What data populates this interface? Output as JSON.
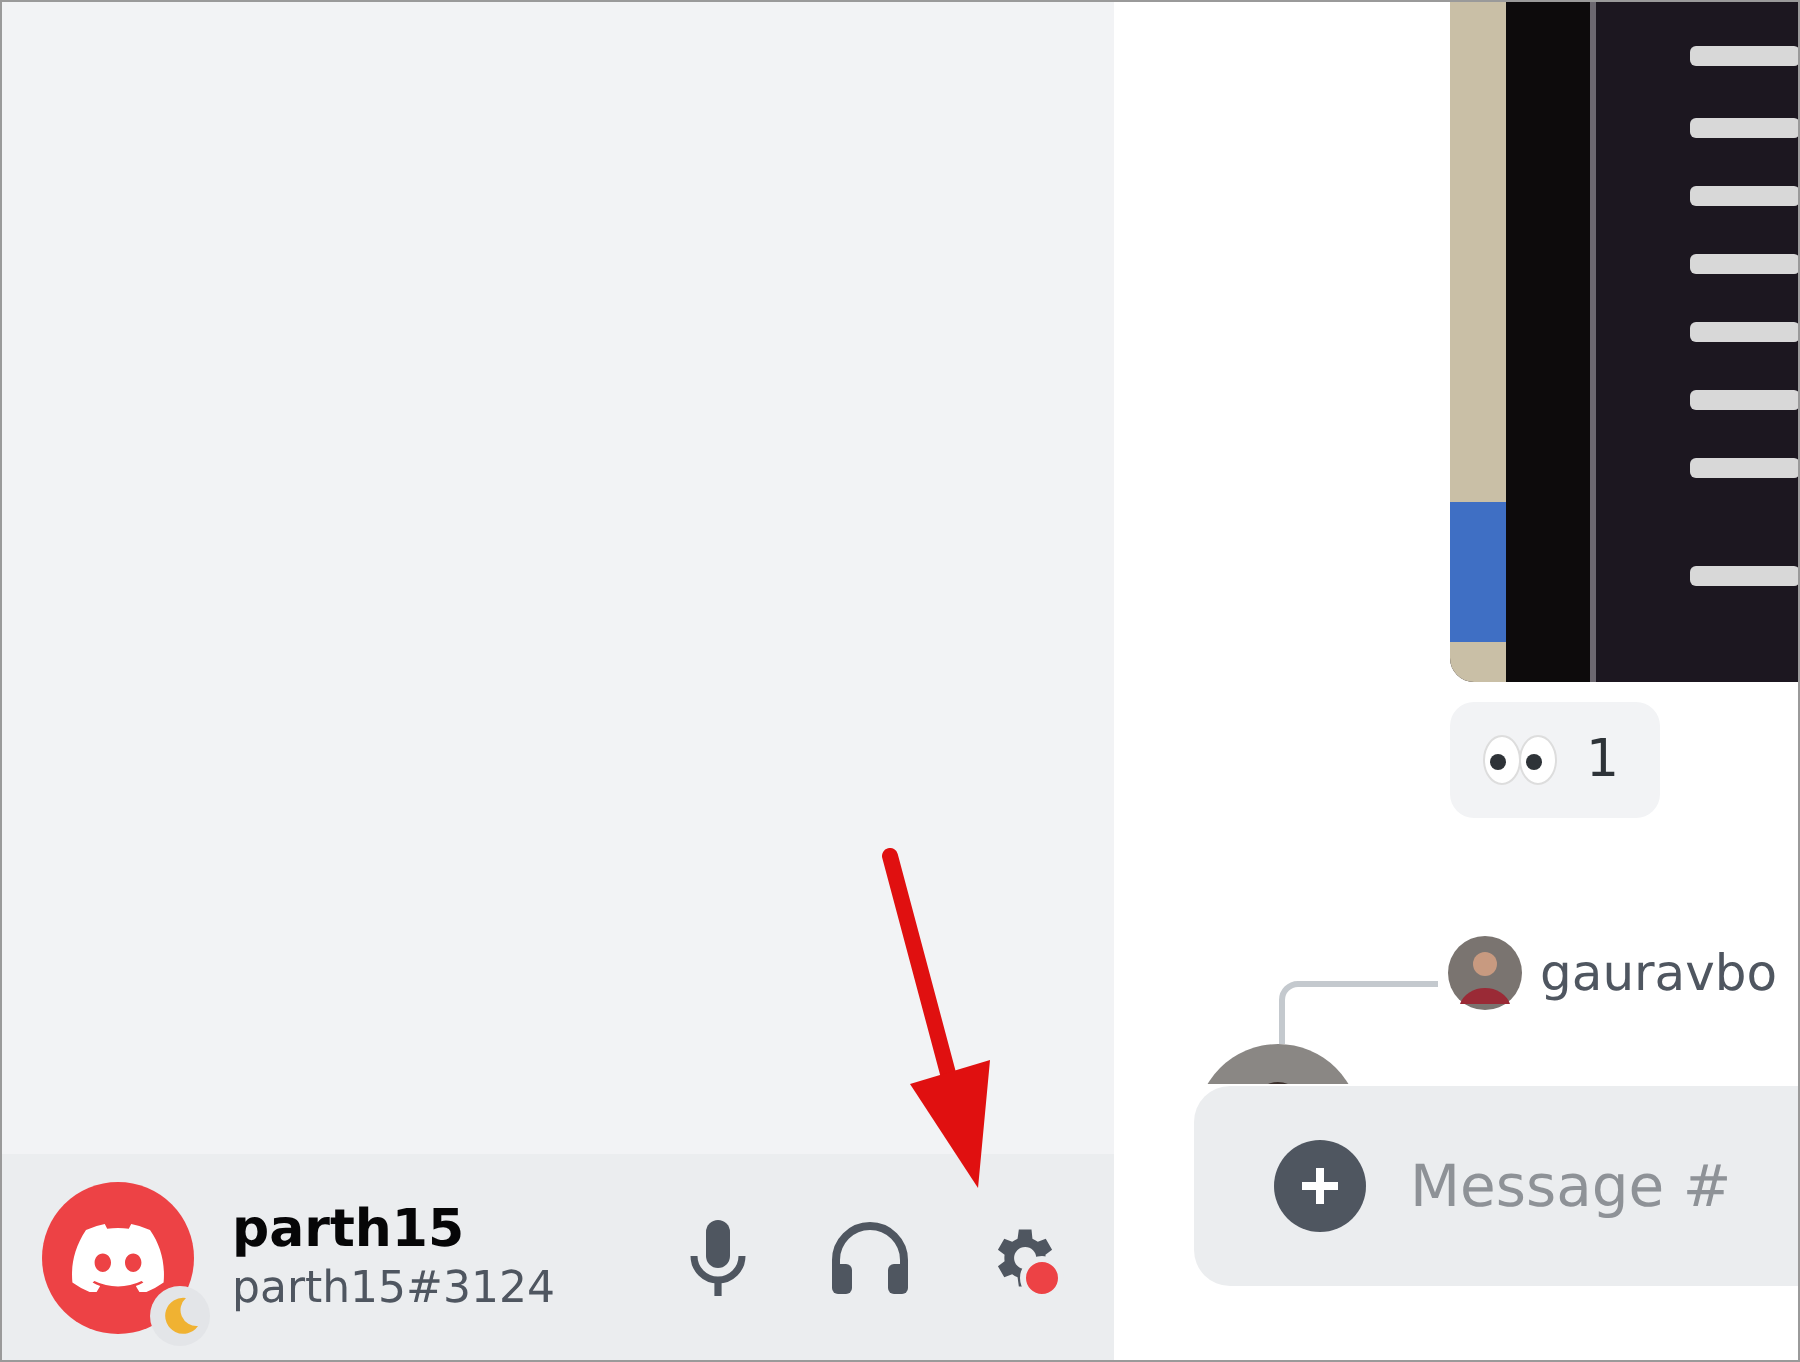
{
  "user_panel": {
    "username": "parth15",
    "tag": "parth15#3124",
    "idle": true,
    "settings_badge": true
  },
  "message": {
    "kind": "picture",
    "reaction": {
      "count": "1"
    }
  },
  "reply": {
    "author": "gauravbo"
  },
  "composer": {
    "placeholder": "Message #"
  }
}
